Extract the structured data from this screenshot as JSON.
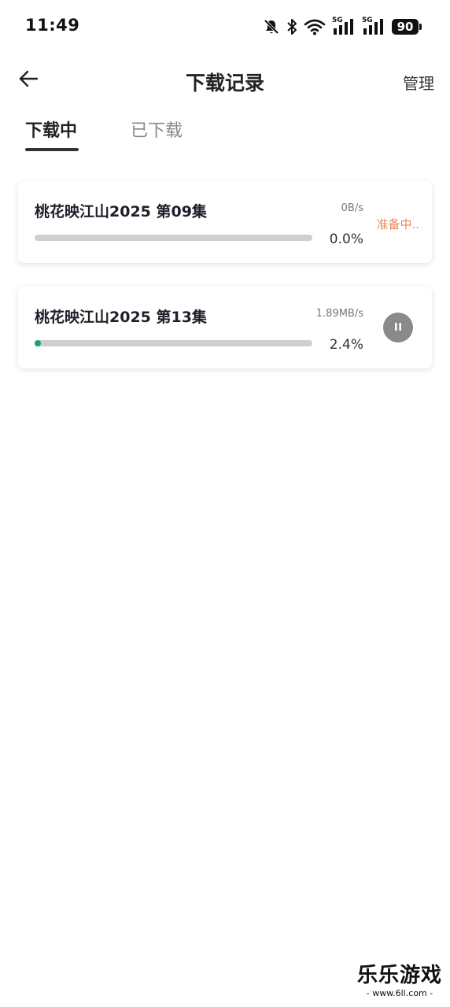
{
  "status_bar": {
    "time": "11:49",
    "icons": [
      "bell-muted-icon",
      "bluetooth-icon",
      "wifi-icon",
      "signal-5g-icon",
      "signal-5g-icon"
    ],
    "signal_label_1": "5G",
    "signal_label_2": "5G",
    "battery": "90"
  },
  "header": {
    "back_icon": "arrow-left-icon",
    "title": "下载记录",
    "manage_label": "管理"
  },
  "tabs": [
    {
      "label": "下载中",
      "active": true
    },
    {
      "label": "已下载",
      "active": false
    }
  ],
  "downloads": [
    {
      "title": "桃花映江山2025 第09集",
      "speed": "0B/s",
      "percent_text": "0.0%",
      "progress": 0.0,
      "status_text": "准备中..",
      "action_icon": null
    },
    {
      "title": "桃花映江山2025 第13集",
      "speed": "1.89MB/s",
      "percent_text": "2.4%",
      "progress": 0.024,
      "status_text": null,
      "action_icon": "pause-icon"
    }
  ],
  "watermark": {
    "title": "乐乐游戏",
    "url": "- www.6ll.com -"
  },
  "colors": {
    "progress_fill": "#1aa36b",
    "progress_track": "#cfcfcf",
    "status_orange": "#e8875f",
    "pause_button": "#8a8a8a"
  }
}
